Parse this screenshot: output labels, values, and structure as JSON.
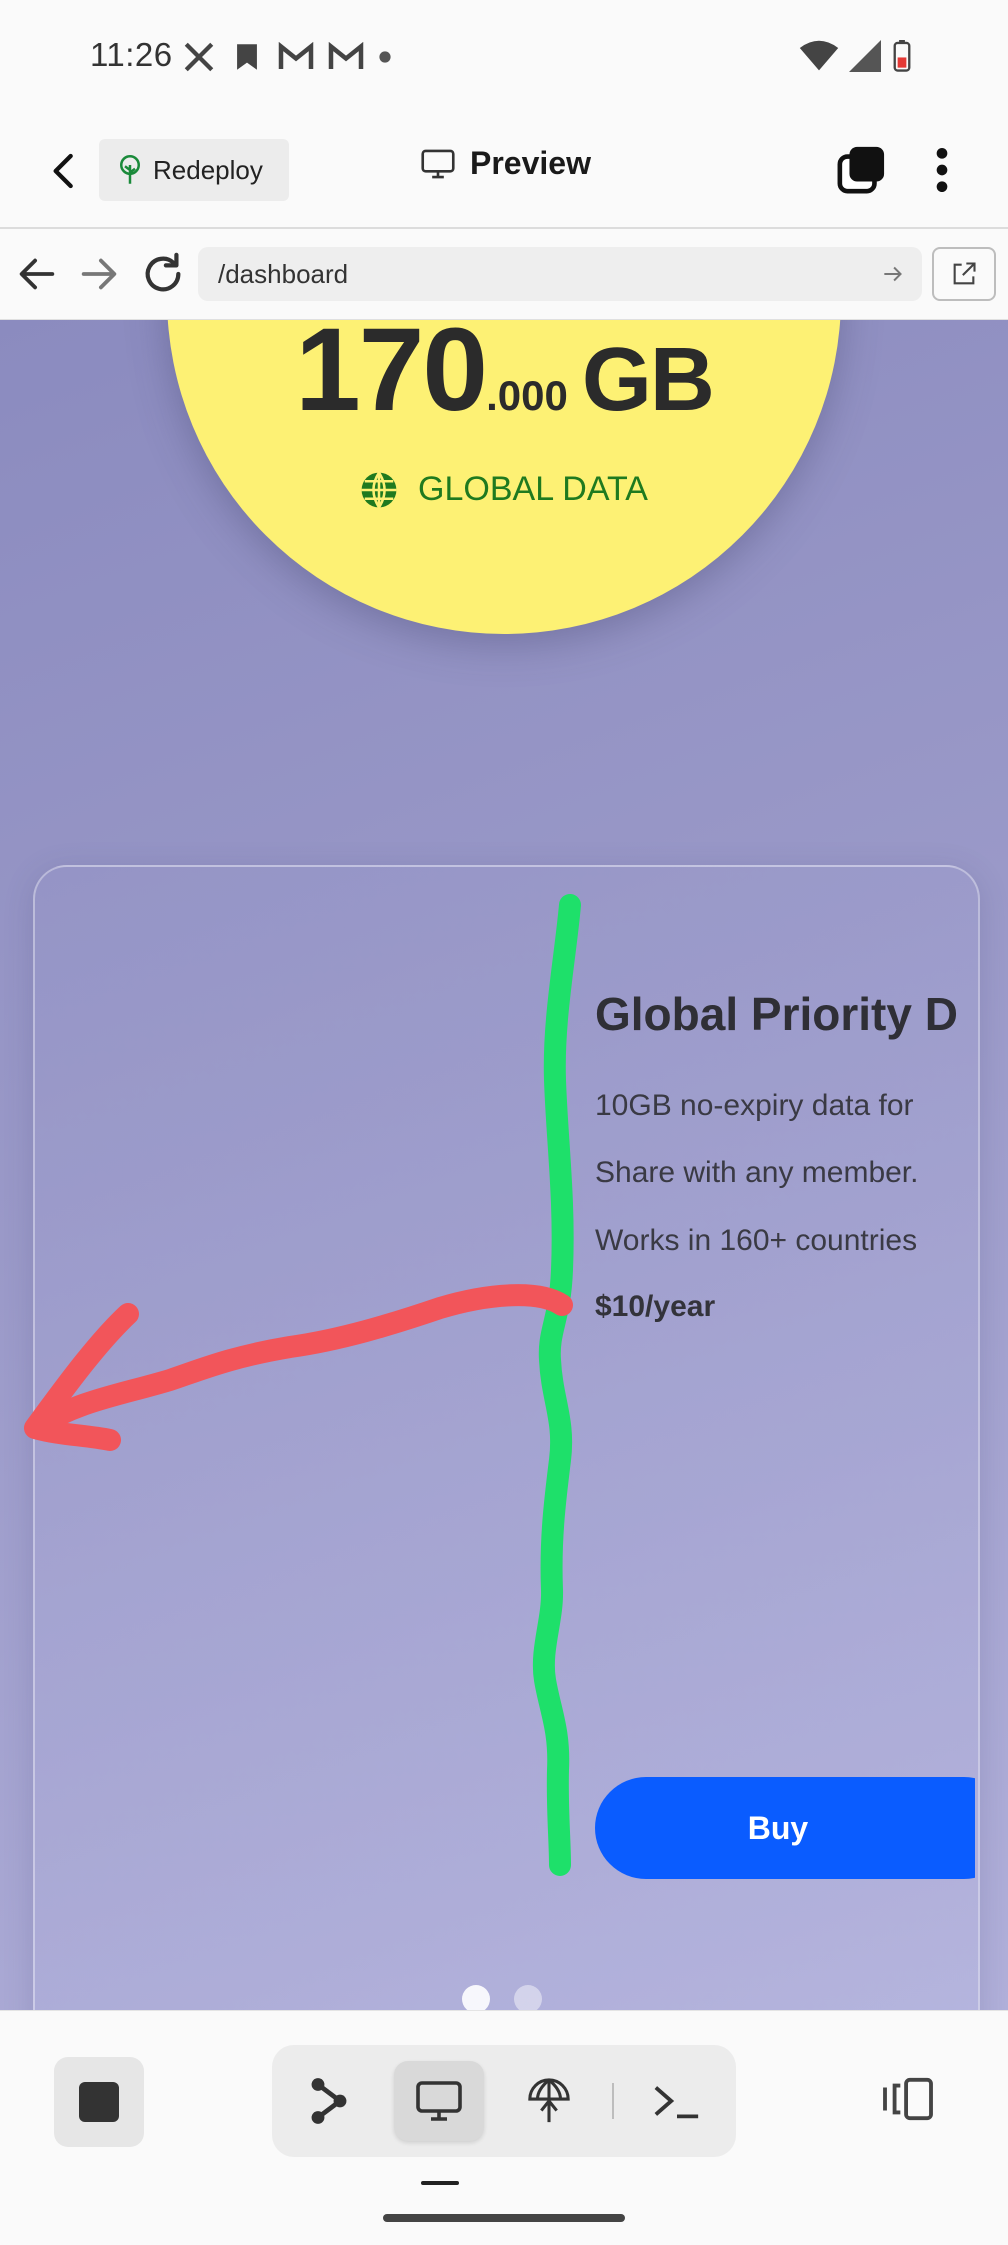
{
  "status_bar": {
    "time": "11:26",
    "left_icons": [
      "x-icon",
      "bookmark-icon",
      "gmail-icon",
      "gmail-icon",
      "dot-icon"
    ],
    "right_icons": [
      "wifi-icon",
      "signal-icon",
      "battery-icon"
    ]
  },
  "app_bar": {
    "redeploy_label": "Redeploy",
    "title": "Preview"
  },
  "url_bar": {
    "path": "/dashboard"
  },
  "hero": {
    "value_int": "170",
    "value_dec": ".000",
    "unit": "GB",
    "label": "GLOBAL DATA"
  },
  "plan_card": {
    "title": "Global Priority D",
    "lines": [
      "10GB no-expiry data for",
      "Share with any member.",
      "Works in 160+ countries"
    ],
    "price": "$10/year",
    "buy_label": "Buy"
  },
  "carousel": {
    "page_count": 2,
    "active_index": 0
  },
  "annotations": {
    "green_stroke_color": "#1ee06a",
    "red_arrow_color": "#f2555a"
  },
  "bottom_bar": {
    "tools": [
      "graph-icon",
      "monitor-icon",
      "globe-icon",
      "terminal-icon"
    ],
    "active_tool": "monitor-icon"
  },
  "colors": {
    "buy_button": "#0a5cff",
    "hero_circle": "#fdf174",
    "global_label": "#1f7a1f"
  }
}
